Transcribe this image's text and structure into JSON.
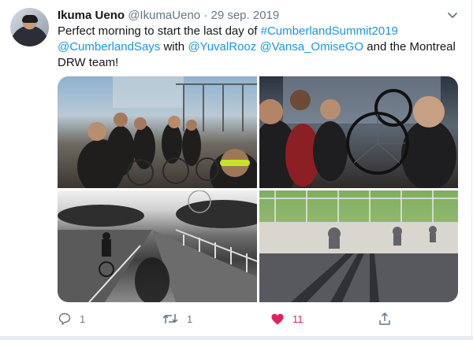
{
  "author": {
    "name": "Ikuma Ueno",
    "handle": "@IkumaUeno",
    "separator": "·",
    "date": "29 sep. 2019"
  },
  "tweet": {
    "t1": "Perfect morning to start the last day of ",
    "l1": "#CumberlandSummit2019",
    "l2": "@CumberlandSays",
    "t2": " with ",
    "l3": "@YuvalRooz",
    "t3": " ",
    "l4": "@Vansa_OmiseGO",
    "t4": " and the Montreal DRW team!"
  },
  "actions": {
    "reply_count": "1",
    "retweet_count": "1",
    "like_count": "11"
  },
  "icons": {
    "reply": "reply-icon",
    "retweet": "retweet-icon",
    "like": "heart-icon",
    "share": "share-icon",
    "menu": "chevron-down-icon"
  },
  "colors": {
    "link": "#1b95e0",
    "like": "#e0245e",
    "muted": "#657786"
  }
}
